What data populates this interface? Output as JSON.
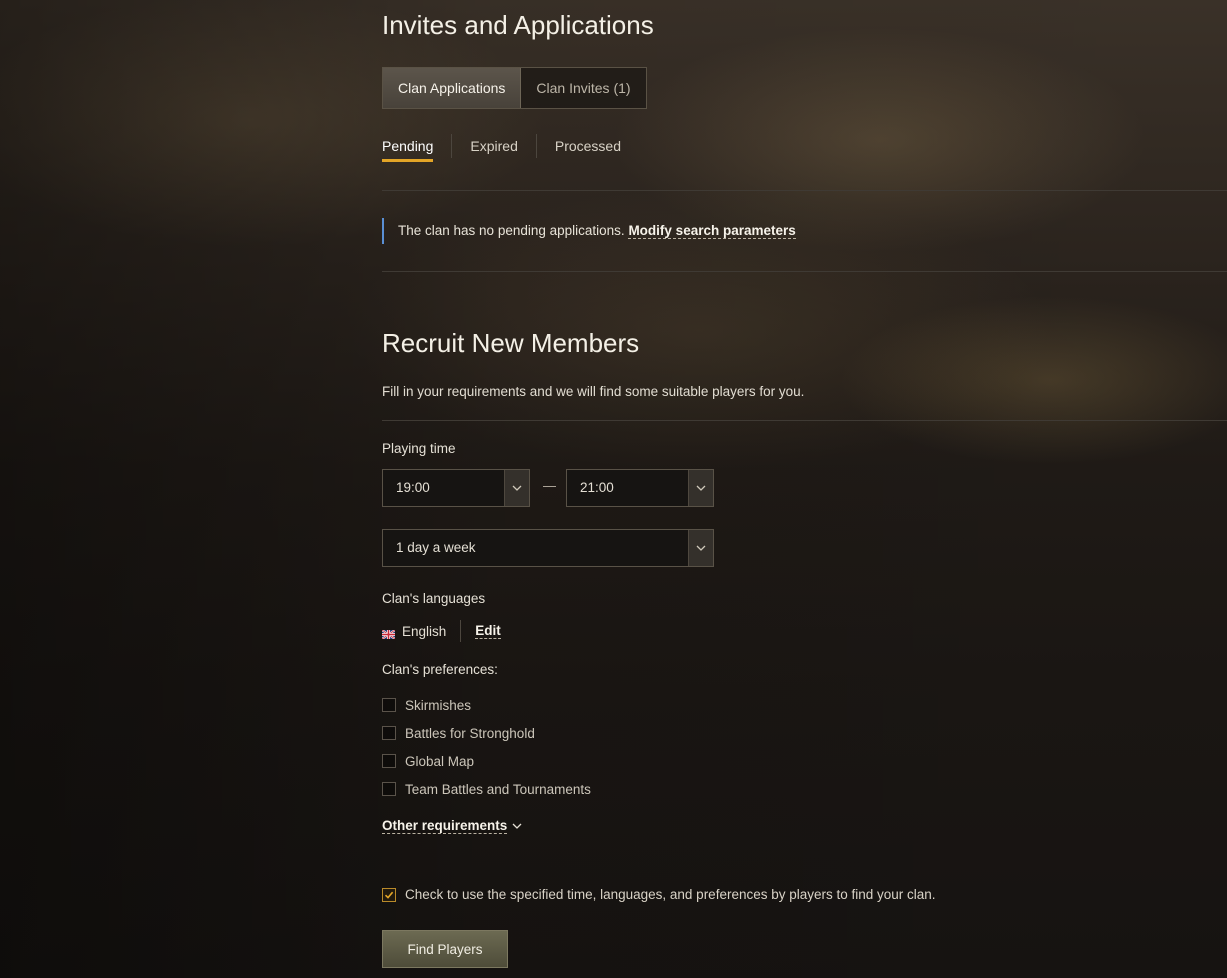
{
  "invites": {
    "title": "Invites and Applications",
    "tabs": [
      {
        "label": "Clan Applications",
        "active": true
      },
      {
        "label": "Clan Invites (1)",
        "active": false
      }
    ],
    "subtabs": [
      {
        "label": "Pending",
        "active": true
      },
      {
        "label": "Expired",
        "active": false
      },
      {
        "label": "Processed",
        "active": false
      }
    ],
    "notice_text": "The clan has no pending applications.",
    "notice_link": "Modify search parameters"
  },
  "recruit": {
    "title": "Recruit New Members",
    "subtitle": "Fill in your requirements and we will find some suitable players for you.",
    "playing_time_label": "Playing time",
    "time_from": "19:00",
    "time_separator": "—",
    "time_to": "21:00",
    "frequency": "1 day a week",
    "languages_label": "Clan's languages",
    "language": "English",
    "edit_label": "Edit",
    "preferences_label": "Clan's preferences:",
    "preferences": [
      {
        "label": "Skirmishes",
        "checked": false
      },
      {
        "label": "Battles for Stronghold",
        "checked": false
      },
      {
        "label": "Global Map",
        "checked": false
      },
      {
        "label": "Team Battles and Tournaments",
        "checked": false
      }
    ],
    "other_requirements": "Other requirements",
    "agree_text": "Check to use the specified time, languages, and preferences by players to find your clan.",
    "agree_checked": true,
    "find_button": "Find Players"
  },
  "colors": {
    "accent": "#e3a527",
    "notice_bar": "#5a8fd4",
    "button": "#5d5b45"
  },
  "icons": {
    "select_arrow": "chevron-down-icon",
    "flag": "uk-flag-icon",
    "checkmark": "checkmark-icon"
  }
}
